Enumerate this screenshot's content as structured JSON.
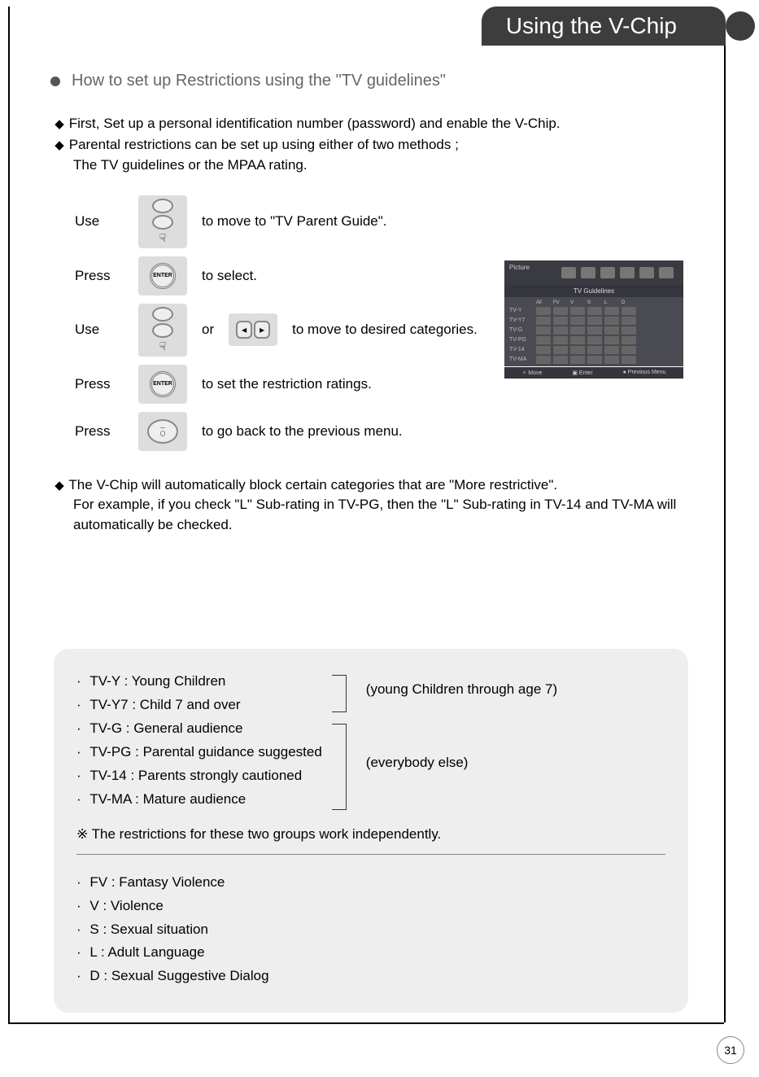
{
  "header": {
    "title": "Using the V-Chip"
  },
  "section": {
    "heading": "How to set up Restrictions using the \"TV guidelines\""
  },
  "intro": {
    "line1": "First, Set up a personal identification number (password) and enable the V-Chip.",
    "line2": "Parental restrictions can be set up using either of two methods ;",
    "line3": "The TV guidelines or the MPAA rating."
  },
  "steps": [
    {
      "verb": "Use",
      "after": "to move to \"TV Parent Guide\"."
    },
    {
      "verb": "Press",
      "after": "to select."
    },
    {
      "verb": "Use",
      "after_pre": "or",
      "after": "to move to desired categories."
    },
    {
      "verb": "Press",
      "after": "to set the restriction ratings."
    },
    {
      "verb": "Press",
      "after": "to go back to the previous menu."
    }
  ],
  "note": {
    "l1": "The V-Chip will automatically block certain categories that are \"More restrictive\".",
    "l2": "For example, if you check \"L\" Sub-rating in TV-PG, then the \"L\" Sub-rating in TV-14 and TV-MA will",
    "l3": "automatically be checked."
  },
  "screenshot": {
    "sidebar": "Picture",
    "heading": "TV Guidelines",
    "cols": [
      "All",
      "FV",
      "V",
      "S",
      "L",
      "D"
    ],
    "rows": [
      "TV-Y",
      "TV-Y7",
      "TV-G",
      "TV-PG",
      "TV-14",
      "TV-MA"
    ],
    "footer": [
      "Move",
      "Enter",
      "Previous Menu"
    ]
  },
  "legend": {
    "ratings": [
      "TV-Y : Young Children",
      "TV-Y7 : Child 7 and over",
      "TV-G : General audience",
      "TV-PG : Parental guidance suggested",
      "TV-14 : Parents strongly cautioned",
      "TV-MA : Mature audience"
    ],
    "group1": "(young Children through age 7)",
    "group2": "(everybody else)",
    "note": "※  The restrictions for these two groups work independently.",
    "subratings": [
      "FV : Fantasy Violence",
      "V : Violence",
      "S : Sexual situation",
      "L :  Adult Language",
      "D : Sexual Suggestive Dialog"
    ]
  },
  "page": "31"
}
